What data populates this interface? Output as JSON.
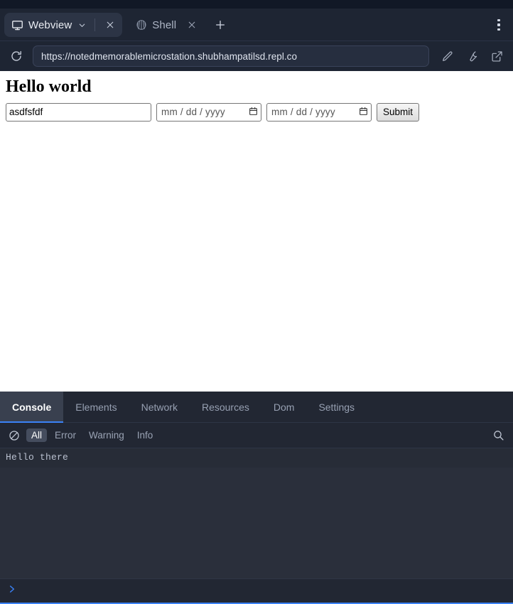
{
  "window": {
    "tabs": [
      {
        "label": "Webview",
        "icon": "monitor-icon",
        "active": true,
        "has_dropdown": true
      },
      {
        "label": "Shell",
        "icon": "shell-icon",
        "active": false,
        "has_dropdown": false
      }
    ],
    "new_tab_label": "+",
    "menu_icon": "kebab-menu-icon"
  },
  "urlbar": {
    "reload_icon": "reload-icon",
    "url": "https://notedmemorablemicrostation.shubhampatilsd.repl.co",
    "placeholder": "Enter URL",
    "actions": [
      {
        "icon": "pencil-icon",
        "name": "edit-button"
      },
      {
        "icon": "wrench-icon",
        "name": "devtools-toggle-button"
      },
      {
        "icon": "external-link-icon",
        "name": "open-in-browser-button"
      }
    ]
  },
  "page": {
    "heading": "Hello world",
    "text_input_value": "asdfsfdf",
    "text_input_placeholder": "",
    "date_inputs": [
      {
        "placeholder": "mm / dd / yyyy",
        "value": ""
      },
      {
        "placeholder": "mm / dd / yyyy",
        "value": ""
      }
    ],
    "submit_label": "Submit"
  },
  "devtools": {
    "tabs": [
      {
        "label": "Console",
        "active": true
      },
      {
        "label": "Elements",
        "active": false
      },
      {
        "label": "Network",
        "active": false
      },
      {
        "label": "Resources",
        "active": false
      },
      {
        "label": "Dom",
        "active": false
      },
      {
        "label": "Settings",
        "active": false
      }
    ],
    "clear_icon": "clear-console-icon",
    "filters": [
      {
        "label": "All",
        "active": true
      },
      {
        "label": "Error",
        "active": false
      },
      {
        "label": "Warning",
        "active": false
      },
      {
        "label": "Info",
        "active": false
      }
    ],
    "search_icon": "search-icon",
    "logs": [
      {
        "text": "Hello there",
        "level": "log"
      }
    ],
    "prompt_icon": "chevron-right-icon",
    "prompt_value": ""
  },
  "colors": {
    "chrome_bg": "#1e2533",
    "top_strip": "#111826",
    "devtools_bg": "#222733",
    "console_bg": "#2a2f3b",
    "accent_blue": "#3b82f6",
    "page_bg": "#ffffff"
  }
}
